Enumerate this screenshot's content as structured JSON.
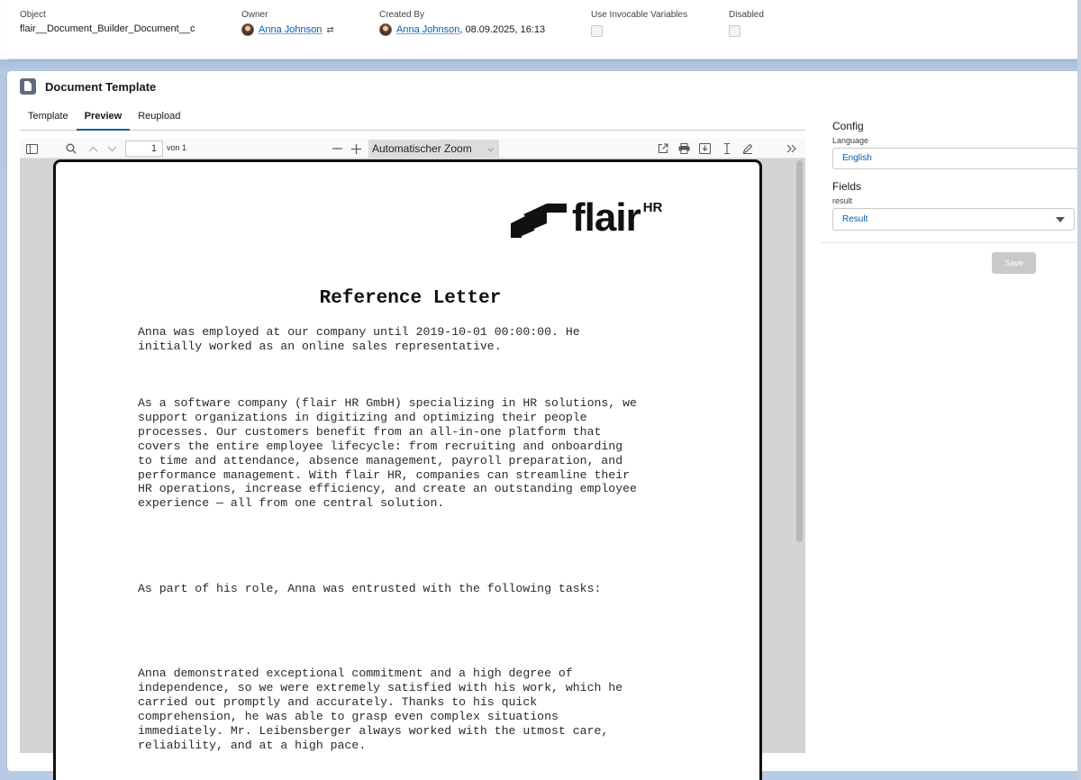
{
  "highlights": {
    "object": {
      "label": "Object",
      "value": "flair__Document_Builder_Document__c"
    },
    "owner": {
      "label": "Owner",
      "name": "Anna Johnson"
    },
    "created_by": {
      "label": "Created By",
      "name": "Anna Johnson",
      "date": ", 08.09.2025, 16:13"
    },
    "use_invocable": {
      "label": "Use Invocable Variables",
      "checked": false
    },
    "disabled": {
      "label": "Disabled",
      "checked": false
    }
  },
  "card": {
    "title": "Document Template",
    "tabs": [
      {
        "label": "Template",
        "active": false
      },
      {
        "label": "Preview",
        "active": true
      },
      {
        "label": "Reupload",
        "active": false
      }
    ]
  },
  "pdf_toolbar": {
    "page_number": "1",
    "page_of": "von 1",
    "zoom": "Automatischer Zoom",
    "icons": [
      "sidebar-toggle-icon",
      "search-icon",
      "chevron-up-icon",
      "chevron-down-icon",
      "minus-icon",
      "plus-icon",
      "open-external-icon",
      "print-icon",
      "download-icon",
      "text-cursor-icon",
      "pen-icon",
      "double-chevron-right-icon"
    ]
  },
  "document": {
    "logo_text": "flair",
    "logo_superscript": "HR",
    "title": "Reference Letter",
    "paragraphs": [
      "Anna was employed at our company until 2019-10-01 00:00:00. He\ninitially worked as an online sales representative.",
      "As a software company (flair HR GmbH) specializing in HR solutions, we\nsupport organizations in digitizing and optimizing their people\nprocesses. Our customers benefit from an all-in-one platform that\ncovers the entire employee lifecycle: from recruiting and onboarding\nto time and attendance, absence management, payroll preparation, and\nperformance management. With flair HR, companies can streamline their\nHR operations, increase efficiency, and create an outstanding employee\nexperience — all from one central solution.",
      "As part of his role, Anna was entrusted with the following tasks:",
      "Anna demonstrated exceptional commitment and a high degree of\nindependence, so we were extremely satisfied with his work, which he\ncarried out promptly and accurately. Thanks to his quick\ncomprehension, he was able to grasp even complex situations\nimmediately. Mr. Leibensberger always worked with the utmost care,\nreliability, and at a high pace."
    ]
  },
  "config": {
    "heading": "Config",
    "language_label": "Language",
    "language_value": "English",
    "fields_heading": "Fields",
    "result_label": "result",
    "result_value": "Result",
    "save_label": "Save"
  }
}
